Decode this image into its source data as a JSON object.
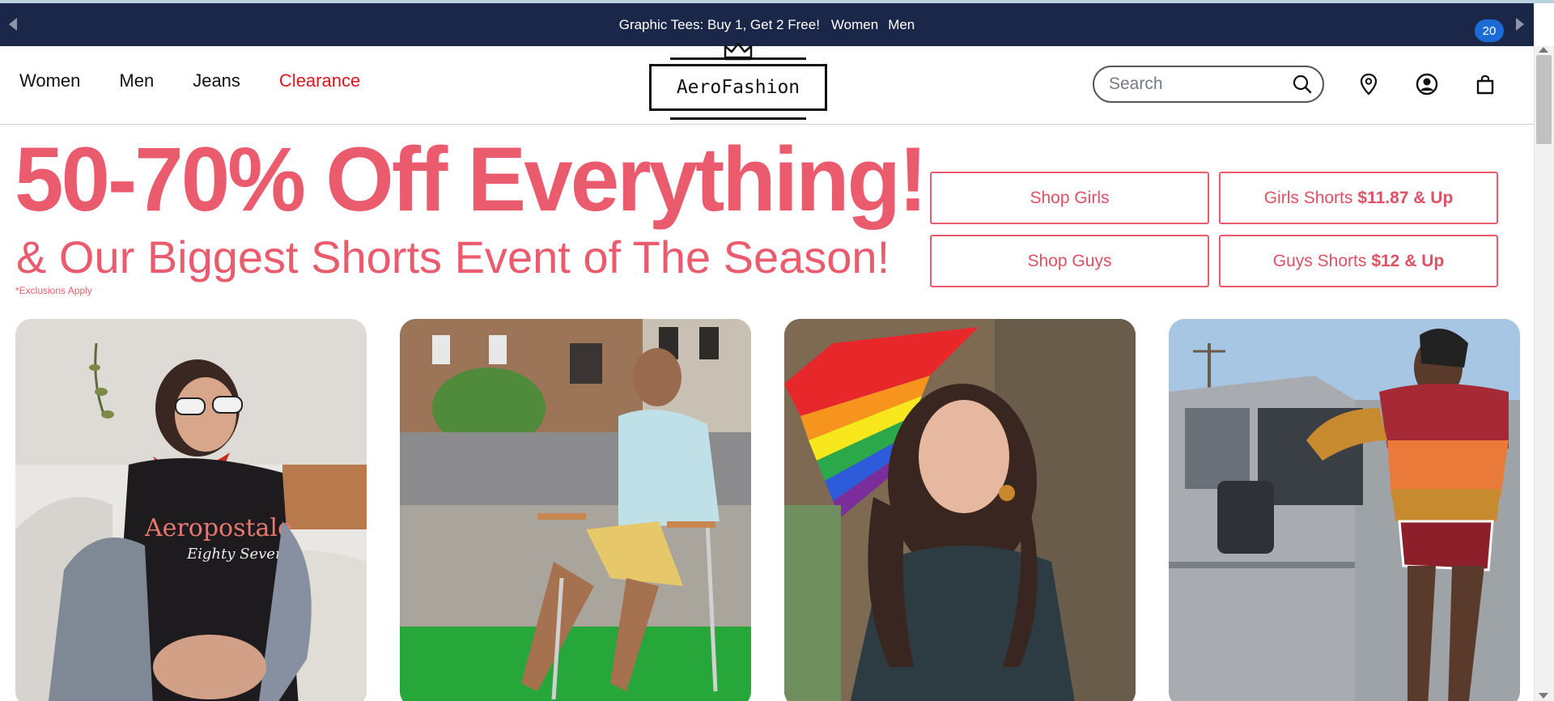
{
  "promo": {
    "text": "Graphic Tees: Buy 1, Get 2 Free!",
    "links": [
      "Women",
      "Men"
    ]
  },
  "nav": {
    "items": [
      "Women",
      "Men",
      "Jeans",
      "Clearance"
    ]
  },
  "brand": {
    "logo_text": "AeroFashion"
  },
  "search": {
    "placeholder": "Search",
    "value": ""
  },
  "bag": {
    "count": "20"
  },
  "hero": {
    "title": "50-70% Off Everything!",
    "subtitle": "& Our Biggest Shorts Event of The Season!",
    "note": "*Exclusions Apply",
    "buttons": [
      {
        "label": "Shop Girls",
        "suffix": ""
      },
      {
        "label": "Girls Shorts",
        "suffix": "$11.87 & Up"
      },
      {
        "label": "Shop Guys",
        "suffix": ""
      },
      {
        "label": "Guys Shorts",
        "suffix": "$12 & Up"
      }
    ]
  },
  "tiles": {
    "tile1_shirt_text": "Aeropostale",
    "tile1_shirt_sub": "Eighty Seven"
  },
  "colors": {
    "promo_bg": "#1b2748",
    "accent": "#ea5c6d",
    "clearance": "#e2131d",
    "badge": "#1c6ad6"
  },
  "icons": [
    "chevron-left-icon",
    "chevron-right-icon",
    "crown-icon",
    "search-icon",
    "location-pin-icon",
    "account-icon",
    "shopping-bag-icon"
  ]
}
